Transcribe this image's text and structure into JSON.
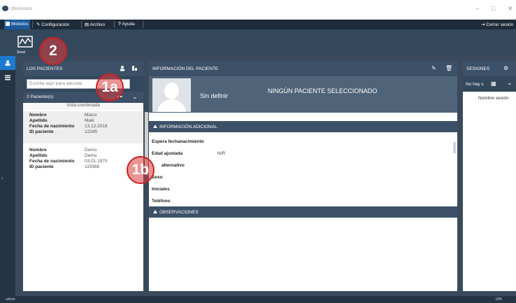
{
  "window": {
    "title": "OtoAccess",
    "minimize": "–",
    "maximize": "□",
    "close": "✕"
  },
  "menubar": {
    "items": [
      {
        "label": "Módulos"
      },
      {
        "label": "Configuración"
      },
      {
        "label": "Archivo"
      },
      {
        "label": "Ayuda"
      }
    ],
    "logout": "Cerrar sesión"
  },
  "ribbon": {
    "session_label": "Sessi"
  },
  "patients_panel": {
    "title": "LOS PACIENTES",
    "search_placeholder": "Escriba aquí para ejecutar",
    "count_label": "2 Paciente(s)",
    "view_mode": "Vista combinada",
    "patients": [
      {
        "nombre": "Maico",
        "apellido": "Maik",
        "nacimiento": "13.12.2018",
        "id": "12345"
      },
      {
        "nombre": "Demo",
        "apellido": "Demo",
        "nacimiento": "03.01.1970",
        "id": "115566"
      }
    ],
    "field_labels": {
      "nombre": "Nombre",
      "apellido": "Apellido",
      "nacimiento": "Fecha de nacimiento",
      "id": "ID paciente"
    }
  },
  "info_panel": {
    "title": "INFORMACIÓN DEL PACIENTE",
    "name_placeholder": "Sin definir",
    "status": "NINGÚN PACIENTE SELECCIONADO",
    "additional_section": "INFORMACIÓN ADICIONAL",
    "fields": [
      {
        "label": "Espera fechanacimiento",
        "value": ""
      },
      {
        "label": "Edad ajustada",
        "value": "N/R"
      },
      {
        "label": "alternativo",
        "value": ""
      },
      {
        "label": "Sexo",
        "value": ""
      },
      {
        "label": "Iniciales",
        "value": ""
      },
      {
        "label": "Teléfono",
        "value": ""
      }
    ],
    "observations_section": "OBSERVACIONES"
  },
  "sessions_panel": {
    "title": "SESIONES",
    "filter_label": "No hay s",
    "column_label": "Nombre sesión"
  },
  "callouts": [
    "1a",
    "1b",
    "2"
  ],
  "statusbar": {
    "left": "admin",
    "right": "SPA"
  },
  "colors": {
    "header": "#3c5068",
    "accent": "#1d7ad1",
    "callout": "#cc2222"
  }
}
